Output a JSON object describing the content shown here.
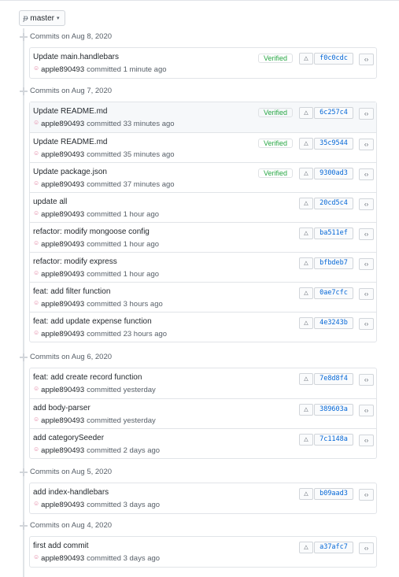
{
  "branch": {
    "icon": "git-branch-icon",
    "name": "master"
  },
  "groups": [
    {
      "date_label": "Commits on Aug 8, 2020",
      "commits": [
        {
          "message": "Update main.handlebars",
          "author": "apple890493",
          "action": "committed",
          "time": "1 minute ago",
          "verified": "Verified",
          "sha": "f0c0cdc",
          "highlight": false
        }
      ]
    },
    {
      "date_label": "Commits on Aug 7, 2020",
      "commits": [
        {
          "message": "Update README.md",
          "author": "apple890493",
          "action": "committed",
          "time": "33 minutes ago",
          "verified": "Verified",
          "sha": "6c257c4",
          "highlight": true
        },
        {
          "message": "Update README.md",
          "author": "apple890493",
          "action": "committed",
          "time": "35 minutes ago",
          "verified": "Verified",
          "sha": "35c9544",
          "highlight": false
        },
        {
          "message": "Update package.json",
          "author": "apple890493",
          "action": "committed",
          "time": "37 minutes ago",
          "verified": "Verified",
          "sha": "9300ad3",
          "highlight": false
        },
        {
          "message": "update all",
          "author": "apple890493",
          "action": "committed",
          "time": "1 hour ago",
          "verified": "",
          "sha": "20cd5c4",
          "highlight": false
        },
        {
          "message": "refactor: modify mongoose config",
          "author": "apple890493",
          "action": "committed",
          "time": "1 hour ago",
          "verified": "",
          "sha": "ba511ef",
          "highlight": false
        },
        {
          "message": "refactor: modify express",
          "author": "apple890493",
          "action": "committed",
          "time": "1 hour ago",
          "verified": "",
          "sha": "bfbdeb7",
          "highlight": false
        },
        {
          "message": "feat: add filter function",
          "author": "apple890493",
          "action": "committed",
          "time": "3 hours ago",
          "verified": "",
          "sha": "0ae7cfc",
          "highlight": false
        },
        {
          "message": "feat: add update expense function",
          "author": "apple890493",
          "action": "committed",
          "time": "23 hours ago",
          "verified": "",
          "sha": "4e3243b",
          "highlight": false
        }
      ]
    },
    {
      "date_label": "Commits on Aug 6, 2020",
      "commits": [
        {
          "message": "feat: add create record function",
          "author": "apple890493",
          "action": "committed",
          "time": "yesterday",
          "verified": "",
          "sha": "7e8d8f4",
          "highlight": false
        },
        {
          "message": "add body-parser",
          "author": "apple890493",
          "action": "committed",
          "time": "yesterday",
          "verified": "",
          "sha": "389603a",
          "highlight": false
        },
        {
          "message": "add categorySeeder",
          "author": "apple890493",
          "action": "committed",
          "time": "2 days ago",
          "verified": "",
          "sha": "7c1148a",
          "highlight": false
        }
      ]
    },
    {
      "date_label": "Commits on Aug 5, 2020",
      "commits": [
        {
          "message": "add index-handlebars",
          "author": "apple890493",
          "action": "committed",
          "time": "3 days ago",
          "verified": "",
          "sha": "b09aad3",
          "highlight": false
        }
      ]
    },
    {
      "date_label": "Commits on Aug 4, 2020",
      "commits": [
        {
          "message": "first add commit",
          "author": "apple890493",
          "action": "committed",
          "time": "3 days ago",
          "verified": "",
          "sha": "a37afc7",
          "highlight": false
        }
      ]
    }
  ],
  "icons": {
    "copy": "clipboard-icon",
    "browse": "code-icon",
    "avatar": "avatar-icon"
  }
}
